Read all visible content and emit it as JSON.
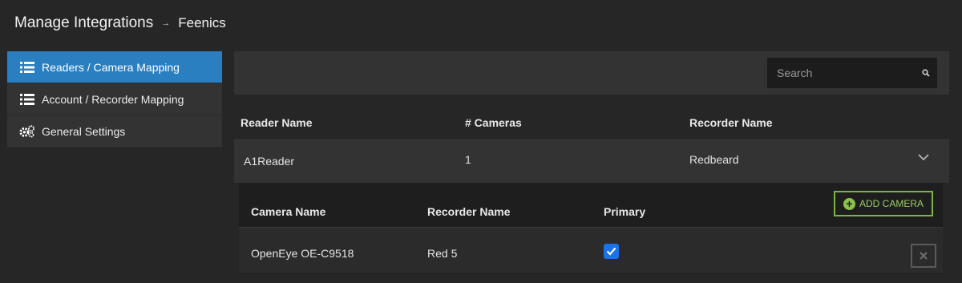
{
  "header": {
    "title": "Manage Integrations",
    "separator": "→",
    "subtitle": "Feenics"
  },
  "sidebar": {
    "items": [
      {
        "label": "Readers / Camera Mapping",
        "icon": "list-icon",
        "active": true
      },
      {
        "label": "Account / Recorder Mapping",
        "icon": "list-icon",
        "active": false
      },
      {
        "label": "General Settings",
        "icon": "gears-icon",
        "active": false
      }
    ]
  },
  "search": {
    "placeholder": "Search",
    "icon": "search-icon"
  },
  "table": {
    "columns": [
      "Reader Name",
      "# Cameras",
      "Recorder Name"
    ],
    "rows": [
      {
        "reader_name": "A1Reader",
        "cameras": "1",
        "recorder_name": "Redbeard",
        "expanded": true
      }
    ]
  },
  "camera_table": {
    "columns": [
      "Camera Name",
      "Recorder Name",
      "Primary"
    ],
    "add_button_label": "ADD CAMERA",
    "rows": [
      {
        "camera_name": "OpenEye OE-C9518",
        "recorder_name": "Red 5",
        "primary": true
      }
    ]
  },
  "colors": {
    "accent": "#2a7fc1",
    "add_button": "#7cb342",
    "checkbox": "#1a73e8"
  }
}
